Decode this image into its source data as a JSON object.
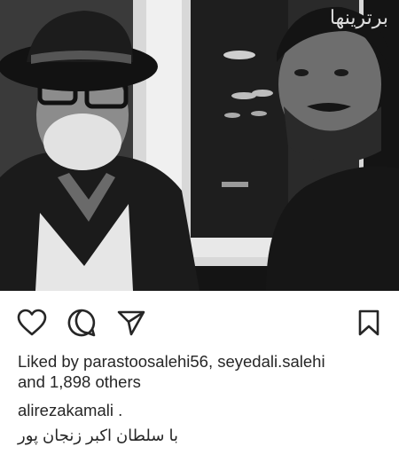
{
  "post": {
    "image_alt": "Black and white selfie of two men",
    "watermark": "برترینها"
  },
  "actions": {
    "like_icon": "heart-icon",
    "comment_icon": "comment-icon",
    "share_icon": "send-icon",
    "save_icon": "bookmark-icon"
  },
  "likes": {
    "line1": "Liked by parastoosalehi56, seyedali.salehi",
    "line2": "and 1,898 others"
  },
  "caption": {
    "username_line": "alirezakamali .",
    "text": "با سلطان اکبر زنجان پور"
  },
  "colors": {
    "text": "#262626",
    "background": "#ffffff"
  }
}
